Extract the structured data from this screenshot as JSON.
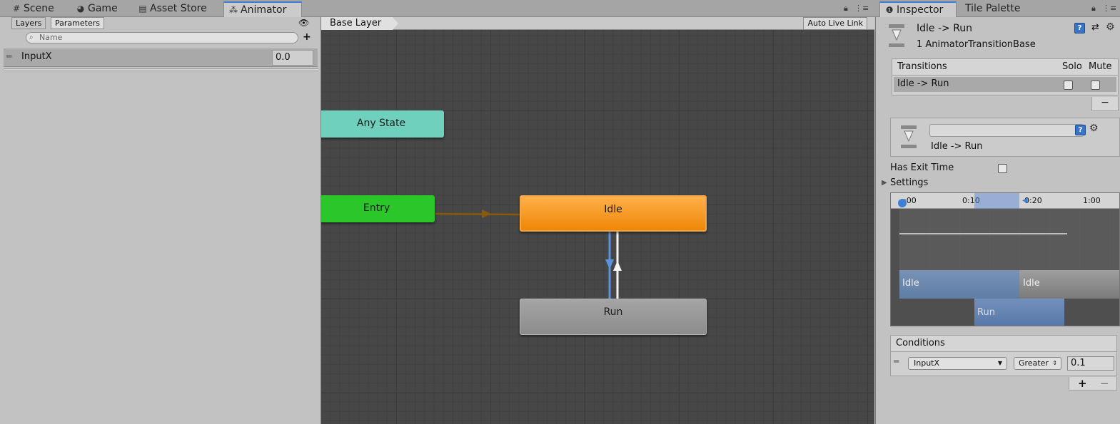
{
  "tabs": [
    {
      "label": "Scene",
      "icon": "grid-icon"
    },
    {
      "label": "Game",
      "icon": "pacman-icon"
    },
    {
      "label": "Asset Store",
      "icon": "store-icon"
    },
    {
      "label": "Animator",
      "icon": "animator-icon"
    }
  ],
  "inspector_tabs": [
    {
      "label": "Inspector",
      "icon": "info-icon"
    },
    {
      "label": "Tile Palette"
    }
  ],
  "left_panel": {
    "tabs": [
      "Layers",
      "Parameters"
    ],
    "search_placeholder": "Name",
    "parameters": [
      {
        "name": "InputX",
        "value": "0.0"
      }
    ]
  },
  "graph": {
    "breadcrumb": "Base Layer",
    "auto_live_link": "Auto Live Link",
    "nodes": {
      "any_state": "Any State",
      "entry": "Entry",
      "idle": "Idle",
      "run": "Run"
    }
  },
  "inspector": {
    "title": "Idle -> Run",
    "subtitle": "1 AnimatorTransitionBase",
    "transitions_header": "Transitions",
    "solo_label": "Solo",
    "mute_label": "Mute",
    "transition_row": "Idle -> Run",
    "minus_label": "−",
    "transition_name": "Idle -> Run",
    "has_exit_time_label": "Has Exit Time",
    "settings_label": "Settings",
    "timeline_labels": [
      ":00",
      "0:10",
      "0:20",
      "1:00"
    ],
    "timeline_tracks": {
      "src_a": "Idle",
      "src_b": "Idle",
      "dst": "Run"
    },
    "conditions_header": "Conditions",
    "condition": {
      "parameter": "InputX",
      "mode": "Greater",
      "value": "0.1"
    },
    "plus_label": "+",
    "minus_label2": "−"
  },
  "colors": {
    "entry": "#2bc52b",
    "any_state": "#6bcfbb",
    "idle": "#f08d10",
    "run": "#9a9a9a",
    "accent": "#3d7fd6"
  }
}
